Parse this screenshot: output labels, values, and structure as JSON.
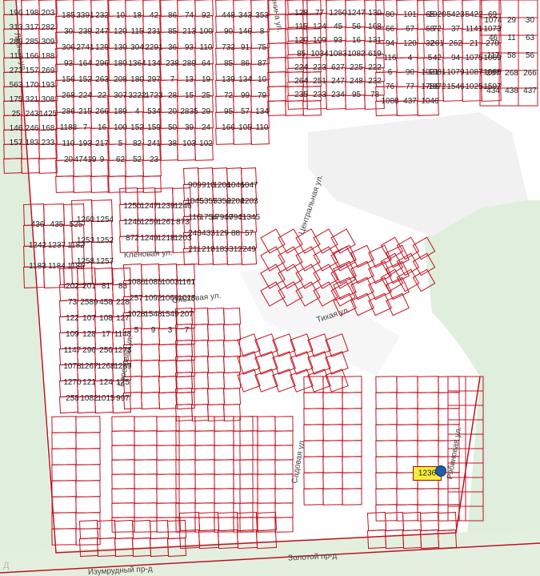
{
  "map": {
    "parcel_numbers": [
      "196",
      "198",
      "203",
      "313",
      "317",
      "282",
      "283",
      "285",
      "309",
      "111",
      "166",
      "188",
      "273",
      "157",
      "269",
      "563",
      "170",
      "193",
      "175",
      "321",
      "308",
      "25",
      "243",
      "1425",
      "146",
      "246",
      "168",
      "157",
      "183",
      "233",
      "185",
      "3391",
      "232",
      "30",
      "239",
      "247",
      "306",
      "2741",
      "129",
      "93",
      "164",
      "296",
      "156",
      "152",
      "263",
      "268",
      "224",
      "22",
      "286",
      "215",
      "266",
      "1188",
      "7",
      "16",
      "110",
      "193",
      "217",
      "20",
      "47419",
      "9",
      "10",
      "18",
      "42",
      "120",
      "115",
      "231",
      "130",
      "304",
      "2291",
      "180",
      "1364",
      "134",
      "208",
      "180",
      "297",
      "307",
      "3222",
      "1723",
      "189",
      "4",
      "534",
      "100",
      "152",
      "159",
      "5",
      "82",
      "241",
      "62",
      "52",
      "23",
      "86",
      "74",
      "92",
      "85",
      "213",
      "100",
      "36",
      "93",
      "110",
      "238",
      "289",
      "64",
      "7",
      "13",
      "19",
      "28",
      "15",
      "25",
      "20",
      "2835",
      "29",
      "50",
      "39",
      "24",
      "38",
      "103",
      "102",
      "448",
      "343",
      "353",
      "90",
      "146",
      "8",
      "732",
      "91",
      "75",
      "85",
      "86",
      "87",
      "139",
      "134",
      "10",
      "72",
      "99",
      "79",
      "95",
      "57",
      "134",
      "166",
      "105",
      "110",
      "128",
      "77",
      "1250",
      "1247",
      "130",
      "115",
      "124",
      "45",
      "56",
      "168",
      "120",
      "109",
      "93",
      "16",
      "131",
      "85",
      "1034",
      "1083",
      "1082",
      "619",
      "224",
      "223",
      "627",
      "225",
      "222",
      "264",
      "251",
      "247",
      "248",
      "232",
      "235",
      "233",
      "234",
      "95",
      "78",
      "80",
      "101",
      "65",
      "66",
      "67",
      "68",
      "94",
      "120",
      "32",
      "116",
      "4",
      "5",
      "6",
      "90",
      "1021",
      "76",
      "77",
      "1786",
      "1088",
      "437",
      "1046",
      "1020",
      "5423",
      "5422",
      "69",
      "72",
      "37",
      "1141",
      "1073",
      "261",
      "262",
      "21",
      "270",
      "42",
      "94",
      "1075",
      "1069",
      "1081",
      "1079",
      "1087",
      "1068",
      "1072",
      "1546",
      "1025",
      "1597",
      "1074",
      "29",
      "30",
      "46",
      "11",
      "63",
      "117",
      "58",
      "56",
      "267",
      "268",
      "266",
      "434",
      "438",
      "437",
      "436",
      "435",
      "525",
      "1242",
      "1237",
      "1182",
      "1183",
      "1184",
      "1185",
      "1260",
      "1254",
      "1253",
      "1252",
      "1258",
      "1257",
      "1250",
      "1247",
      "1239",
      "1246",
      "1245",
      "1259",
      "1261",
      "873",
      "872",
      "1249",
      "1218",
      "1203",
      "909",
      "910",
      "1204",
      "1046",
      "1047",
      "1045",
      "5357",
      "5356",
      "2204",
      "2203",
      "116",
      "1754",
      "17940",
      "17941",
      "11345",
      "243",
      "433",
      "129",
      "88",
      "57",
      "211",
      "218",
      "183",
      "312",
      "249",
      "202",
      "201",
      "81",
      "83",
      "73",
      "2589",
      "458",
      "228",
      "122",
      "107",
      "108",
      "127",
      "109",
      "128",
      "17",
      "1148",
      "1147",
      "296",
      "256",
      "1273",
      "1078",
      "1267",
      "1268",
      "1269",
      "1270",
      "121",
      "124",
      "125",
      "258",
      "1082",
      "1015",
      "997",
      "1086",
      "1085",
      "1003",
      "1161",
      "257",
      "1092",
      "1066",
      "1018",
      "1028",
      "1548",
      "1549",
      "207",
      "5",
      "9",
      "3",
      "7"
    ],
    "street_names": [
      "Ленина ул.",
      "Лесная ул.",
      "Центральная ул.",
      "Кленовая ул.",
      "Ольховая ул.",
      "Тихая ул.",
      "Изумрудный пр-д",
      "Золотой пр-д",
      "Садовая ул.",
      "Березовая ул.",
      "Рябиновая ул."
    ],
    "selected_parcel": "1236",
    "watermark": "Д"
  }
}
